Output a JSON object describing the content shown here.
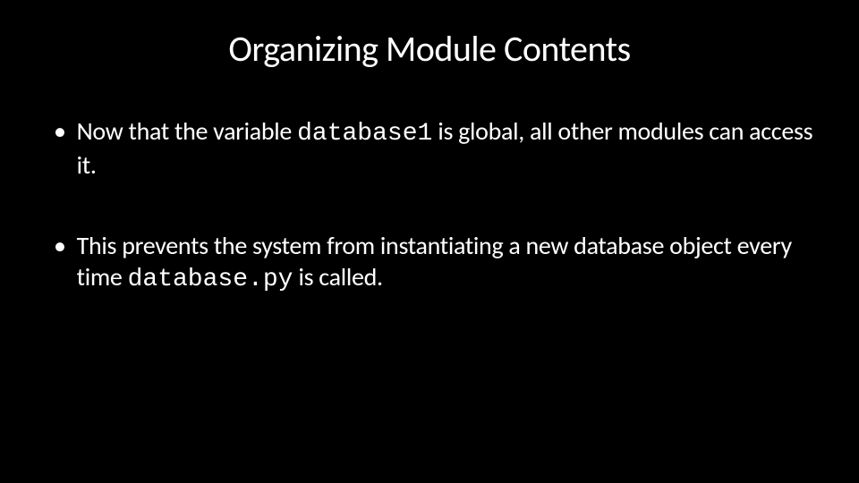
{
  "slide": {
    "title": "Organizing Module Contents",
    "bullets": [
      {
        "pre": "Now that the variable ",
        "code": "database1",
        "post": " is global, all other modules can access it."
      },
      {
        "pre": "This prevents the system from instantiating a new database object every time ",
        "code": "database.py",
        "post": " is called."
      }
    ]
  }
}
